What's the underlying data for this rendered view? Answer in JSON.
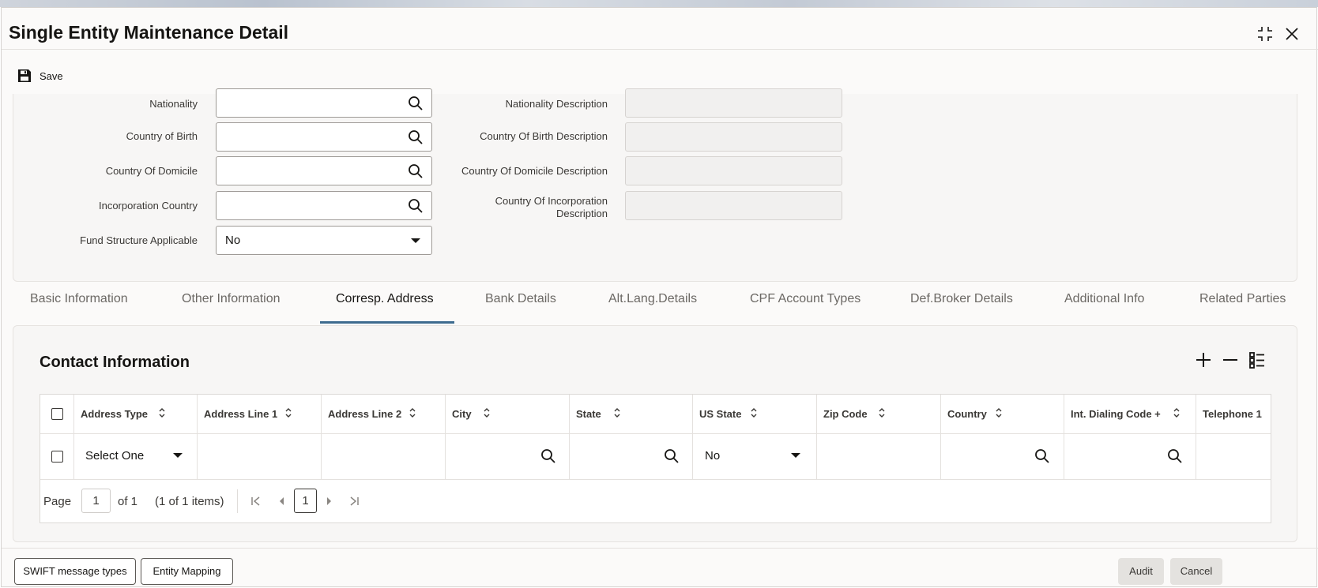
{
  "window": {
    "title": "Single Entity Maintenance Detail"
  },
  "toolbar": {
    "save_label": "Save"
  },
  "form": {
    "nationality_label": "Nationality",
    "nationality_value": "",
    "nationality_desc_label": "Nationality Description",
    "country_of_birth_label": "Country of Birth",
    "country_of_birth_value": "",
    "country_of_birth_desc_label": "Country Of Birth Description",
    "country_of_domicile_label": "Country Of Domicile",
    "country_of_domicile_value": "",
    "country_of_domicile_desc_label": "Country Of Domicile Description",
    "incorporation_country_label": "Incorporation Country",
    "incorporation_country_value": "",
    "incorporation_desc_label_line1": "Country Of Incorporation",
    "incorporation_desc_label_line2": "Description",
    "fund_structure_label": "Fund Structure Applicable",
    "fund_structure_value": "No"
  },
  "tabs": [
    {
      "label": "Basic Information",
      "active": false
    },
    {
      "label": "Other Information",
      "active": false
    },
    {
      "label": "Corresp. Address",
      "active": true
    },
    {
      "label": "Bank Details",
      "active": false
    },
    {
      "label": "Alt.Lang.Details",
      "active": false
    },
    {
      "label": "CPF Account Types",
      "active": false
    },
    {
      "label": "Def.Broker Details",
      "active": false
    },
    {
      "label": "Additional Info",
      "active": false
    },
    {
      "label": "Related Parties",
      "active": false
    }
  ],
  "contact": {
    "title": "Contact Information",
    "columns": [
      "Address Type",
      "Address Line 1",
      "Address Line 2",
      "City",
      "State",
      "US State",
      "Zip Code",
      "Country",
      "Int. Dialing Code +",
      "Telephone 1"
    ],
    "row": {
      "address_type": "Select One",
      "us_state": "No"
    },
    "pager": {
      "page_label": "Page",
      "page_value": "1",
      "of_label": "of 1",
      "items_label": "(1 of 1 items)",
      "current_page": "1"
    }
  },
  "footer": {
    "swift_label": "SWIFT message types",
    "entity_mapping_label": "Entity Mapping",
    "audit_label": "Audit",
    "cancel_label": "Cancel"
  },
  "colors": {
    "accent": "#3d6b8f",
    "panel": "#f7f6f5",
    "text": "#161513"
  }
}
